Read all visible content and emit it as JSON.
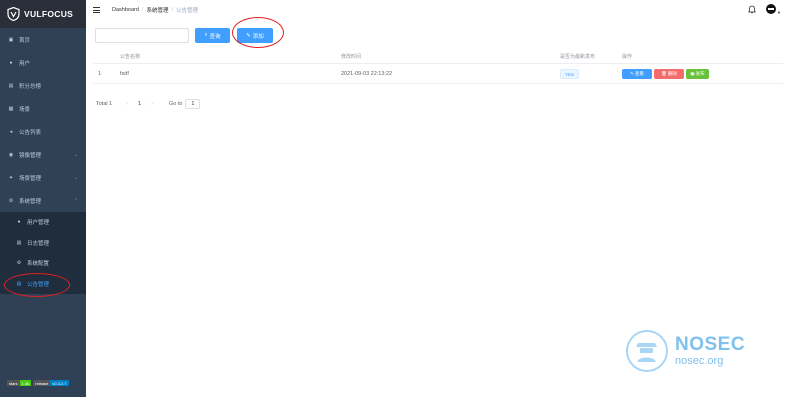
{
  "brand": {
    "name": "VULFOCUS"
  },
  "sidebar": {
    "items": [
      {
        "label": "首页",
        "icon": "dashboard-icon"
      },
      {
        "label": "用户",
        "icon": "user-icon"
      },
      {
        "label": "积分总榜",
        "icon": "rank-icon"
      },
      {
        "label": "场景",
        "icon": "table-icon"
      },
      {
        "label": "公告列表",
        "icon": "notice-icon"
      },
      {
        "label": "镜像管理",
        "icon": "eye-icon"
      },
      {
        "label": "场景管理",
        "icon": "settings-icon"
      },
      {
        "label": "系统管理",
        "icon": "gear-icon"
      }
    ],
    "system_submenu": [
      {
        "label": "用户管理",
        "icon": "user-icon"
      },
      {
        "label": "日志管理",
        "icon": "log-icon"
      },
      {
        "label": "系统配置",
        "icon": "gear-icon"
      },
      {
        "label": "公告管理",
        "icon": "notice-icon",
        "active": true
      }
    ],
    "badges": [
      {
        "key": "stars",
        "value": "1.4k",
        "color": "#44cc11"
      },
      {
        "key": "release",
        "value": "v0.3.2.7",
        "color": "#007ec6"
      }
    ]
  },
  "navbar": {
    "breadcrumbs": [
      "Dashboard",
      "系统管理",
      "公告管理"
    ]
  },
  "toolbar": {
    "search_placeholder": "",
    "query_label": "查询",
    "add_label": "添加"
  },
  "table": {
    "columns": [
      "公告名称",
      "修改时间",
      "是否为最新发布",
      "操作"
    ],
    "rows": [
      {
        "index": "1",
        "name": "fsdf",
        "modified": "2021-09-03 22:13:22",
        "latest": "YES"
      }
    ],
    "actions": {
      "edit": "查看",
      "delete": "删除",
      "publish": "发布"
    }
  },
  "pagination": {
    "total_label": "Total 1",
    "prev": "‹",
    "page": "1",
    "next": "›",
    "goto_label": "Go to",
    "goto_value": "1"
  },
  "watermark": {
    "title": "NOSEC",
    "subtitle": "nosec.org"
  },
  "colors": {
    "sidebar": "#304156",
    "accent": "#409eff",
    "danger": "#f56c6c",
    "success": "#67c23a",
    "highlight": "#e02020"
  }
}
